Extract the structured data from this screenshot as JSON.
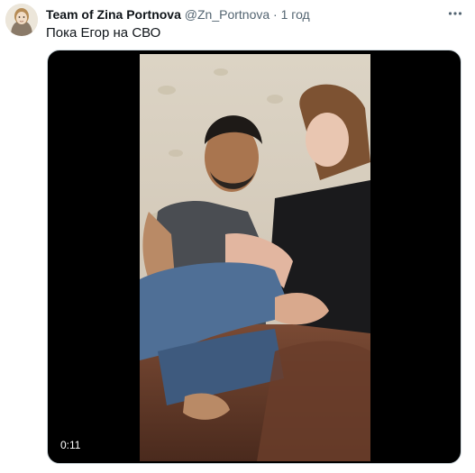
{
  "tweet": {
    "author_name": "Team of Zina Portnova",
    "handle": "@Zn_Portnova",
    "separator": "·",
    "time": "1 год",
    "text": "Пока Егор на СВО",
    "more_icon": "more-horizontal-icon"
  },
  "media": {
    "type": "video",
    "duration": "0:11"
  },
  "colors": {
    "text_primary": "#0f1419",
    "text_secondary": "#536471",
    "media_bg": "#000000"
  }
}
